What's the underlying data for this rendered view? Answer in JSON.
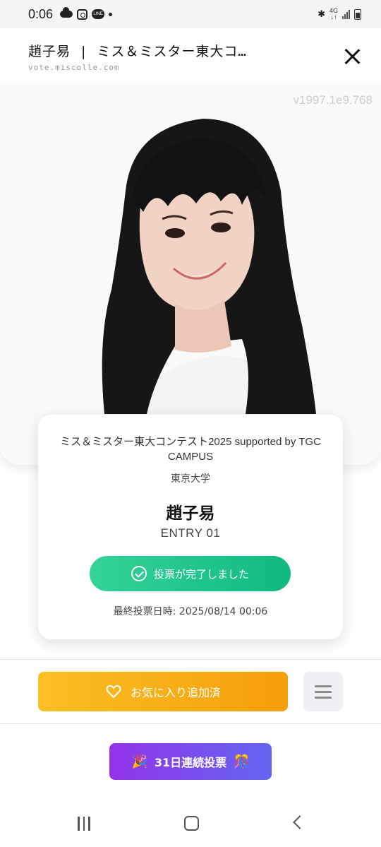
{
  "status_bar": {
    "time": "0:06",
    "network": "4G"
  },
  "browser": {
    "title": "趙子易 | ミス＆ミスター東大コ…",
    "url": "vote.miscolle.com"
  },
  "photo": {
    "watermark": "v1997.1e9.768"
  },
  "candidate": {
    "contest": "ミス＆ミスター東大コンテスト2025 supported by TGC CAMPUS",
    "university": "東京大学",
    "name": "趙子易",
    "entry": "ENTRY 01",
    "vote_status": "投票が完了しました",
    "last_vote": "最終投票日時: 2025/08/14 00:06"
  },
  "actions": {
    "favorite_label": "お気に入り追加済",
    "streak_label": "31日連続投票",
    "streak_emoji_left": "🎉",
    "streak_emoji_right": "🎊"
  },
  "colors": {
    "vote_green": "#10b981",
    "favorite_orange": "#f59e0b",
    "streak_purple": "#9333ea",
    "streak_indigo": "#6366f1"
  },
  "icons": [
    "close-icon",
    "check-circle-icon",
    "heart-icon",
    "menu-icon",
    "party-popper-icon",
    "confetti-ball-icon"
  ]
}
